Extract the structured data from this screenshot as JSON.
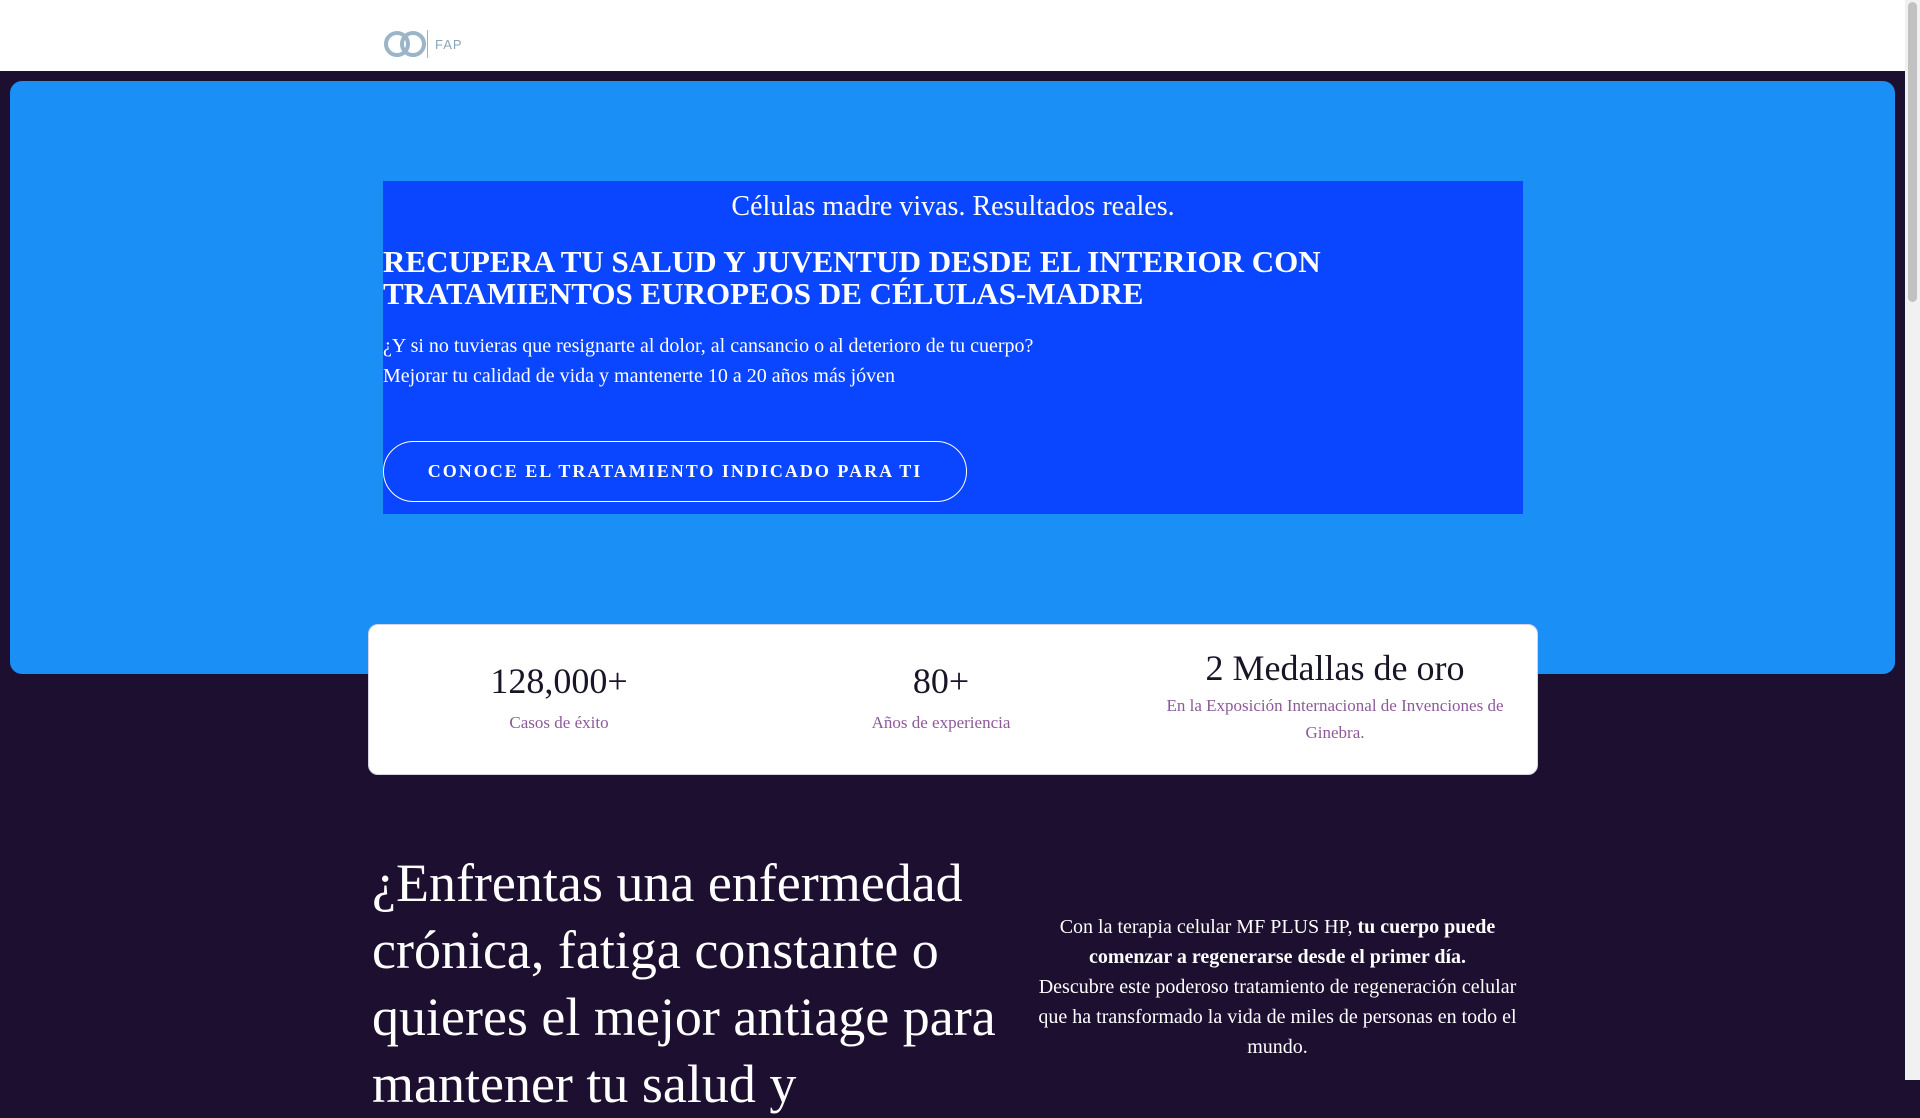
{
  "header": {
    "logo_text": "FAP",
    "logo_icon": "infinity-rings-logo"
  },
  "hero": {
    "tagline": "Células madre vivas. Resultados reales.",
    "headline": "RECUPERA TU SALUD Y JUVENTUD DESDE EL INTERIOR CON TRATAMIENTOS EUROPEOS DE CÉLULAS-MADRE",
    "intro_line1": "¿Y si no tuvieras que resignarte al dolor, al cansancio o al deterioro de tu cuerpo?",
    "intro_line2": "Mejorar tu calidad de vida y mantenerte 10 a 20 años más jóven",
    "cta_label": "CONOCE EL TRATAMIENTO INDICADO PARA TI"
  },
  "stats": [
    {
      "value": "128,000+",
      "label": "Casos de éxito"
    },
    {
      "value": "80+",
      "label": "Años de experiencia"
    },
    {
      "value": "2 Medallas de oro",
      "label": "En la Exposición Internacional de Invenciones de Ginebra."
    }
  ],
  "section": {
    "title": "¿Enfrentas una enfermedad crónica, fatiga constante o quieres el mejor antiage para mantener tu salud y",
    "text_prefix": "Con la terapia celular MF PLUS HP, ",
    "text_bold": "tu cuerpo puede comenzar a regenerarse desde el primer día.",
    "text_rest": "Descubre este poderoso tratamiento de regeneración celular que ha transformado la vida de miles de personas en todo el mundo."
  },
  "colors": {
    "hero_bg": "#1a8ff5",
    "panel_bg": "#0a45ff",
    "page_bg": "#1c0f30",
    "stat_label": "#8c5a99"
  }
}
